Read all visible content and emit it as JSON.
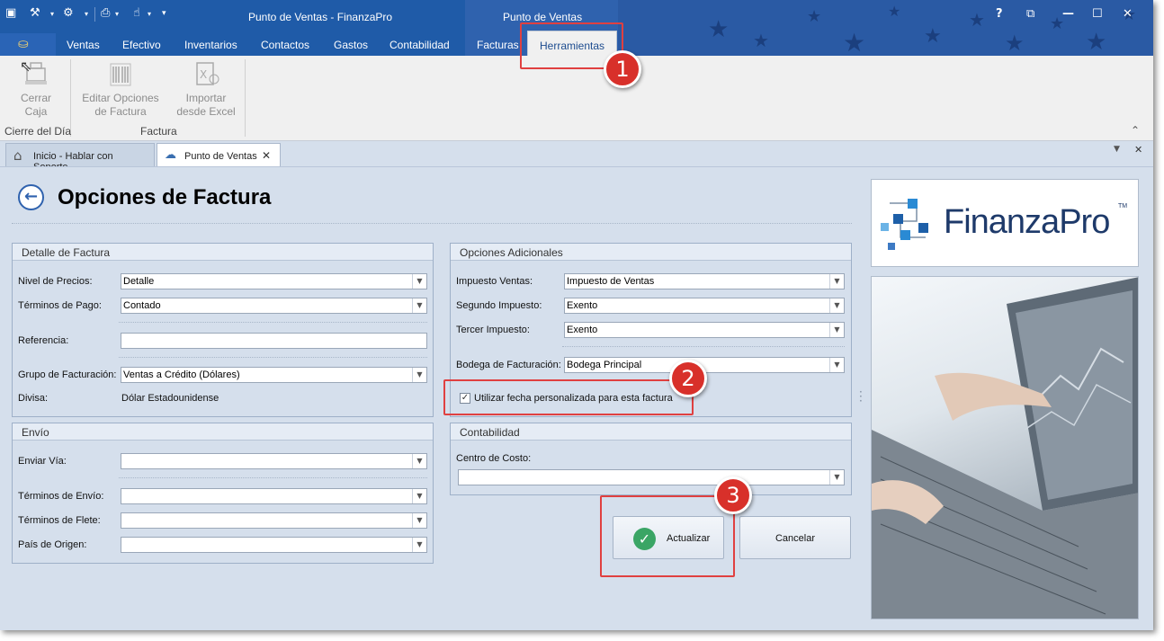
{
  "window": {
    "title": "Punto de Ventas - FinanzaPro",
    "context_title": "Punto de Ventas",
    "help": "?"
  },
  "ribbon_tabs": [
    "Ventas",
    "Efectivo",
    "Inventarios",
    "Contactos",
    "Gastos",
    "Contabilidad",
    "Facturas",
    "Herramientas"
  ],
  "ribbon": {
    "buttons": [
      {
        "label1": "Cerrar",
        "label2": "Caja"
      },
      {
        "label1": "Editar Opciones",
        "label2": "de Factura"
      },
      {
        "label1": "Importar",
        "label2": "desde Excel"
      }
    ],
    "groups": [
      "Cierre del Día",
      "Factura"
    ]
  },
  "doc_tabs": [
    {
      "label": "Inicio - Hablar con Soporte"
    },
    {
      "label": "Punto de Ventas"
    }
  ],
  "page": {
    "title": "Opciones de Factura"
  },
  "detalle": {
    "header": "Detalle de Factura",
    "nivel_label": "Nivel de Precios:",
    "nivel_value": "Detalle",
    "terminos_label": "Términos de Pago:",
    "terminos_value": "Contado",
    "referencia_label": "Referencia:",
    "referencia_value": "",
    "grupo_label": "Grupo de Facturación:",
    "grupo_value": "Ventas a Crédito (Dólares)",
    "divisa_label": "Divisa:",
    "divisa_value": "Dólar Estadounidense"
  },
  "envio": {
    "header": "Envío",
    "via_label": "Enviar Vía:",
    "envio_label": "Términos de Envío:",
    "flete_label": "Términos de Flete:",
    "origen_label": "País de Origen:"
  },
  "adicionales": {
    "header": "Opciones Adicionales",
    "imp1_label": "Impuesto Ventas:",
    "imp1_value": "Impuesto de Ventas",
    "imp2_label": "Segundo Impuesto:",
    "imp2_value": "Exento",
    "imp3_label": "Tercer Impuesto:",
    "imp3_value": "Exento",
    "bodega_label": "Bodega de Facturación:",
    "bodega_value": "Bodega Principal",
    "check_label": "Utilizar fecha personalizada para esta factura",
    "checked": true
  },
  "contabilidad": {
    "header": "Contabilidad",
    "centro_label": "Centro de Costo:"
  },
  "buttons": {
    "actualizar": "Actualizar",
    "cancelar": "Cancelar"
  },
  "brand": {
    "logo_text": "FinanzaPro",
    "tm": "TM"
  },
  "callouts": [
    "1",
    "2",
    "3"
  ],
  "colors": {
    "titlebar": "#1f5ba8",
    "ribbon": "#f0f0f0",
    "content": "#d5dfec",
    "callout": "#d8302a",
    "check_green": "#3aa565"
  }
}
